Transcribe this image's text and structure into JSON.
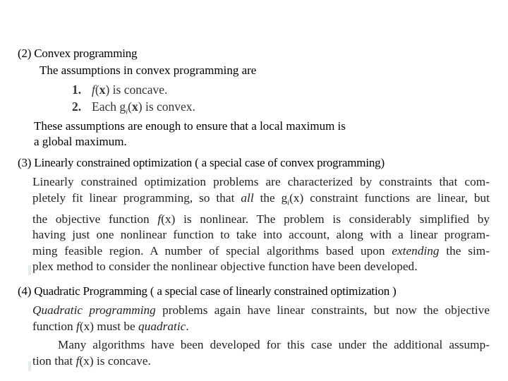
{
  "section2": {
    "heading": "(2) Convex programming",
    "intro": "The assumptions in convex programming are",
    "assumptions": [
      {
        "num": "1.",
        "pre": "f",
        "arg": "(",
        "x": "x",
        "post": ") is concave."
      },
      {
        "num": "2.",
        "pre": "Each g",
        "sub": "i",
        "arg": "(",
        "x": "x",
        "post": ") is convex."
      }
    ],
    "conclusion_line1": "These assumptions are enough to ensure that a local maximum is",
    "conclusion_line2": "a global maximum."
  },
  "section3": {
    "heading": "(3) Linearly constrained optimization ( a special case of convex programming)",
    "lines": [
      "Linearly constrained optimization problems are characterized by constraints that com-",
      "pletely fit linear programming, so that all the gi(x) constraint functions are linear, but",
      "the objective function f(x) is nonlinear. The problem is considerably simplified by",
      "having just one nonlinear function to take into account, along with a linear program-",
      "ming feasible region. A number of special algorithms based upon extending the sim-",
      "plex method to consider the nonlinear objective function have been developed."
    ],
    "l2a": "pletely fit linear programming, so that ",
    "l2_all": "all",
    "l2b": " the g",
    "l2_sub": "i",
    "l2c": "(x) constraint functions are linear, but",
    "l3a": "the objective function ",
    "l3_f": "f",
    "l3b": "(x) is nonlinear. The problem is considerably simplified by",
    "l5a": "ming feasible region. A number of special algorithms based upon ",
    "l5_ext": "extending",
    "l5b": " the sim-"
  },
  "section4": {
    "heading": "(4) Quadratic Programming ( a special case of linearly constrained optimization )",
    "l1_italic": "Quadratic programming",
    "l1_rest": " problems again have linear constraints, but now the objective",
    "l2a": "function ",
    "l2_f": "f",
    "l2b": "(x) must be ",
    "l2_quad": "quadratic",
    "l2c": ".",
    "l3": "Many algorithms have been developed for this case under the additional assump-",
    "l4a": "tion that ",
    "l4_f": "f",
    "l4b": "(x) is concave."
  }
}
